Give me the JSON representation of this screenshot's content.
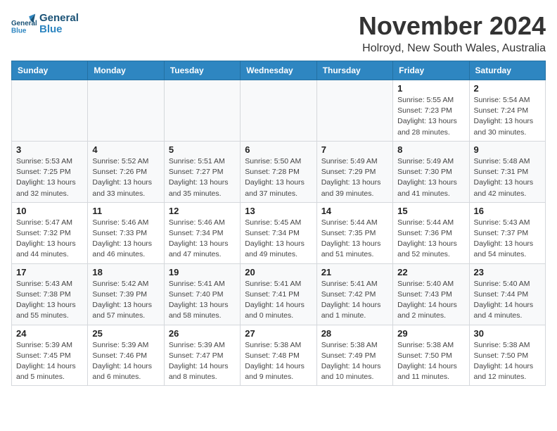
{
  "header": {
    "logo_line1": "General",
    "logo_line2": "Blue",
    "month": "November 2024",
    "location": "Holroyd, New South Wales, Australia"
  },
  "weekdays": [
    "Sunday",
    "Monday",
    "Tuesday",
    "Wednesday",
    "Thursday",
    "Friday",
    "Saturday"
  ],
  "weeks": [
    {
      "days": [
        {
          "num": "",
          "info": ""
        },
        {
          "num": "",
          "info": ""
        },
        {
          "num": "",
          "info": ""
        },
        {
          "num": "",
          "info": ""
        },
        {
          "num": "",
          "info": ""
        },
        {
          "num": "1",
          "info": "Sunrise: 5:55 AM\nSunset: 7:23 PM\nDaylight: 13 hours\nand 28 minutes."
        },
        {
          "num": "2",
          "info": "Sunrise: 5:54 AM\nSunset: 7:24 PM\nDaylight: 13 hours\nand 30 minutes."
        }
      ]
    },
    {
      "days": [
        {
          "num": "3",
          "info": "Sunrise: 5:53 AM\nSunset: 7:25 PM\nDaylight: 13 hours\nand 32 minutes."
        },
        {
          "num": "4",
          "info": "Sunrise: 5:52 AM\nSunset: 7:26 PM\nDaylight: 13 hours\nand 33 minutes."
        },
        {
          "num": "5",
          "info": "Sunrise: 5:51 AM\nSunset: 7:27 PM\nDaylight: 13 hours\nand 35 minutes."
        },
        {
          "num": "6",
          "info": "Sunrise: 5:50 AM\nSunset: 7:28 PM\nDaylight: 13 hours\nand 37 minutes."
        },
        {
          "num": "7",
          "info": "Sunrise: 5:49 AM\nSunset: 7:29 PM\nDaylight: 13 hours\nand 39 minutes."
        },
        {
          "num": "8",
          "info": "Sunrise: 5:49 AM\nSunset: 7:30 PM\nDaylight: 13 hours\nand 41 minutes."
        },
        {
          "num": "9",
          "info": "Sunrise: 5:48 AM\nSunset: 7:31 PM\nDaylight: 13 hours\nand 42 minutes."
        }
      ]
    },
    {
      "days": [
        {
          "num": "10",
          "info": "Sunrise: 5:47 AM\nSunset: 7:32 PM\nDaylight: 13 hours\nand 44 minutes."
        },
        {
          "num": "11",
          "info": "Sunrise: 5:46 AM\nSunset: 7:33 PM\nDaylight: 13 hours\nand 46 minutes."
        },
        {
          "num": "12",
          "info": "Sunrise: 5:46 AM\nSunset: 7:34 PM\nDaylight: 13 hours\nand 47 minutes."
        },
        {
          "num": "13",
          "info": "Sunrise: 5:45 AM\nSunset: 7:34 PM\nDaylight: 13 hours\nand 49 minutes."
        },
        {
          "num": "14",
          "info": "Sunrise: 5:44 AM\nSunset: 7:35 PM\nDaylight: 13 hours\nand 51 minutes."
        },
        {
          "num": "15",
          "info": "Sunrise: 5:44 AM\nSunset: 7:36 PM\nDaylight: 13 hours\nand 52 minutes."
        },
        {
          "num": "16",
          "info": "Sunrise: 5:43 AM\nSunset: 7:37 PM\nDaylight: 13 hours\nand 54 minutes."
        }
      ]
    },
    {
      "days": [
        {
          "num": "17",
          "info": "Sunrise: 5:43 AM\nSunset: 7:38 PM\nDaylight: 13 hours\nand 55 minutes."
        },
        {
          "num": "18",
          "info": "Sunrise: 5:42 AM\nSunset: 7:39 PM\nDaylight: 13 hours\nand 57 minutes."
        },
        {
          "num": "19",
          "info": "Sunrise: 5:41 AM\nSunset: 7:40 PM\nDaylight: 13 hours\nand 58 minutes."
        },
        {
          "num": "20",
          "info": "Sunrise: 5:41 AM\nSunset: 7:41 PM\nDaylight: 14 hours\nand 0 minutes."
        },
        {
          "num": "21",
          "info": "Sunrise: 5:41 AM\nSunset: 7:42 PM\nDaylight: 14 hours\nand 1 minute."
        },
        {
          "num": "22",
          "info": "Sunrise: 5:40 AM\nSunset: 7:43 PM\nDaylight: 14 hours\nand 2 minutes."
        },
        {
          "num": "23",
          "info": "Sunrise: 5:40 AM\nSunset: 7:44 PM\nDaylight: 14 hours\nand 4 minutes."
        }
      ]
    },
    {
      "days": [
        {
          "num": "24",
          "info": "Sunrise: 5:39 AM\nSunset: 7:45 PM\nDaylight: 14 hours\nand 5 minutes."
        },
        {
          "num": "25",
          "info": "Sunrise: 5:39 AM\nSunset: 7:46 PM\nDaylight: 14 hours\nand 6 minutes."
        },
        {
          "num": "26",
          "info": "Sunrise: 5:39 AM\nSunset: 7:47 PM\nDaylight: 14 hours\nand 8 minutes."
        },
        {
          "num": "27",
          "info": "Sunrise: 5:38 AM\nSunset: 7:48 PM\nDaylight: 14 hours\nand 9 minutes."
        },
        {
          "num": "28",
          "info": "Sunrise: 5:38 AM\nSunset: 7:49 PM\nDaylight: 14 hours\nand 10 minutes."
        },
        {
          "num": "29",
          "info": "Sunrise: 5:38 AM\nSunset: 7:50 PM\nDaylight: 14 hours\nand 11 minutes."
        },
        {
          "num": "30",
          "info": "Sunrise: 5:38 AM\nSunset: 7:50 PM\nDaylight: 14 hours\nand 12 minutes."
        }
      ]
    }
  ]
}
